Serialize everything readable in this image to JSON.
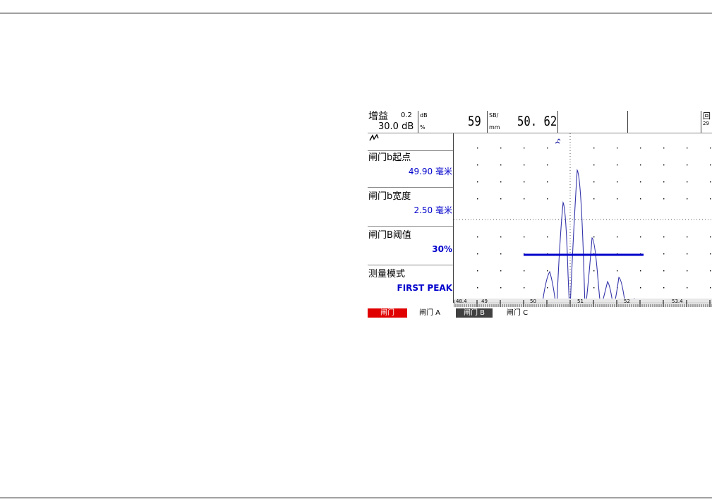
{
  "top_bar": {
    "gain_label": "增益",
    "gain_step": "0.2",
    "gain_value": "30.0 dB",
    "readout1_unit_top": "dB",
    "readout1_unit_bottom": "%",
    "readout1_value": "59",
    "readout2_unit_top": "SB/",
    "readout2_unit_bottom": "mm",
    "readout2_value": "50. 62",
    "corner_icon_text": "回",
    "corner_icon_sub": "29"
  },
  "param_panel": {
    "header_icon": "rectified-wave-icon",
    "items": [
      {
        "label": "闸门b起点",
        "value": "49.90 毫米"
      },
      {
        "label": "闸门b宽度",
        "value": "2.50 毫米"
      },
      {
        "label": "闸门B阈值",
        "value": "30%"
      },
      {
        "label": "测量模式",
        "value": "FIRST PEAK"
      }
    ]
  },
  "ascan": {
    "axis_labels": [
      "48.4",
      "49",
      "50",
      "51",
      "52",
      "53.4"
    ],
    "waveform_color": "#3333aa",
    "gate_color": "#0000cc",
    "gate_b": {
      "start_mm": 49.9,
      "width_mm": 2.5,
      "threshold_percent": 30
    }
  },
  "gate_tabs": [
    "闸门",
    "闸门 A",
    "闸门 B",
    "闸门 C"
  ],
  "colors": {
    "gate_tab_active": "#e00000",
    "gate_tab_b": "#404040",
    "value_text": "#0000cc"
  }
}
